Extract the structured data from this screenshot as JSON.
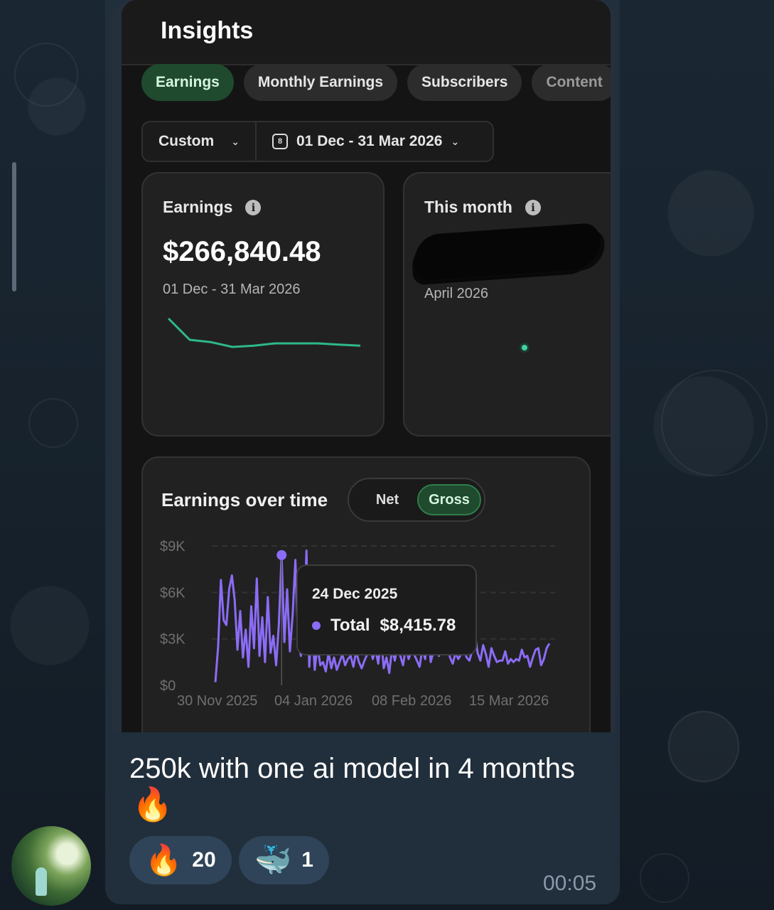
{
  "insights": {
    "title": "Insights",
    "tabs": [
      "Earnings",
      "Monthly Earnings",
      "Subscribers",
      "Content"
    ],
    "filter": {
      "range_type": "Custom",
      "date_range": "01 Dec - 31 Mar 2026"
    },
    "earnings_card": {
      "label": "Earnings",
      "value": "$266,840.48",
      "period": "01 Dec - 31 Mar 2026"
    },
    "month_card": {
      "label": "This month",
      "period": "April 2026"
    },
    "chart_card": {
      "title": "Earnings over time",
      "toggle_net": "Net",
      "toggle_gross": "Gross",
      "tooltip": {
        "date": "24 Dec 2025",
        "label": "Total",
        "value": "$8,415.78"
      }
    }
  },
  "message": {
    "caption": "250k with one ai model in 4 months",
    "emoji": "🔥",
    "reactions": [
      {
        "emoji": "🔥",
        "count": "20"
      },
      {
        "emoji": "🐳",
        "count": "1"
      }
    ],
    "time": "00:05"
  },
  "chart_data": [
    {
      "type": "line",
      "title": "",
      "x": [
        1,
        2,
        3,
        4,
        5,
        6,
        7,
        8,
        9,
        10
      ],
      "values": [
        9.0,
        7.2,
        7.0,
        6.6,
        6.7,
        6.9,
        6.9,
        6.9,
        6.8,
        6.7
      ],
      "color": "#2fb88a",
      "axes_visible": false
    },
    {
      "type": "line",
      "title": "Earnings over time",
      "xlabel": "",
      "ylabel": "",
      "yticks": [
        "$0",
        "$3K",
        "$6K",
        "$9K"
      ],
      "ylim": [
        0,
        9000
      ],
      "xticks": [
        "30 Nov 2025",
        "04 Jan 2026",
        "08 Feb 2026",
        "15 Mar 2026"
      ],
      "grid": true,
      "color": "#8b6cf6",
      "series": [
        {
          "x": [
            "2025-11-30",
            "2025-12-01",
            "2025-12-02",
            "2025-12-03",
            "2025-12-04",
            "2025-12-05",
            "2025-12-06",
            "2025-12-07",
            "2025-12-08",
            "2025-12-09",
            "2025-12-10",
            "2025-12-11",
            "2025-12-12",
            "2025-12-13",
            "2025-12-14",
            "2025-12-15",
            "2025-12-16",
            "2025-12-17",
            "2025-12-18",
            "2025-12-19",
            "2025-12-20",
            "2025-12-21",
            "2025-12-22",
            "2025-12-23",
            "2025-12-24",
            "2025-12-25",
            "2025-12-26",
            "2025-12-27",
            "2025-12-28",
            "2025-12-29",
            "2025-12-30",
            "2025-12-31",
            "2026-01-01",
            "2026-01-02",
            "2026-01-03",
            "2026-01-04",
            "2026-01-05",
            "2026-01-06",
            "2026-01-07",
            "2026-01-08",
            "2026-01-09",
            "2026-01-10",
            "2026-01-11",
            "2026-01-12",
            "2026-01-13",
            "2026-01-14",
            "2026-01-15",
            "2026-01-16",
            "2026-01-17",
            "2026-01-18",
            "2026-01-19",
            "2026-01-20",
            "2026-01-21",
            "2026-01-22",
            "2026-01-23",
            "2026-01-24",
            "2026-01-25",
            "2026-01-26",
            "2026-01-27",
            "2026-01-28",
            "2026-01-29",
            "2026-01-30",
            "2026-01-31",
            "2026-02-01",
            "2026-02-02",
            "2026-02-03",
            "2026-02-04",
            "2026-02-05",
            "2026-02-06",
            "2026-02-07",
            "2026-02-08",
            "2026-02-09",
            "2026-02-10",
            "2026-02-11",
            "2026-02-12",
            "2026-02-13",
            "2026-02-14",
            "2026-02-15",
            "2026-02-16",
            "2026-02-17",
            "2026-02-18",
            "2026-02-19",
            "2026-02-20",
            "2026-02-21",
            "2026-02-22",
            "2026-02-23",
            "2026-02-24",
            "2026-02-25",
            "2026-02-26",
            "2026-02-27",
            "2026-02-28",
            "2026-03-01",
            "2026-03-02",
            "2026-03-03",
            "2026-03-04",
            "2026-03-05",
            "2026-03-06",
            "2026-03-07",
            "2026-03-08",
            "2026-03-09",
            "2026-03-10",
            "2026-03-11",
            "2026-03-12",
            "2026-03-13",
            "2026-03-14",
            "2026-03-15",
            "2026-03-16",
            "2026-03-17",
            "2026-03-18",
            "2026-03-19",
            "2026-03-20",
            "2026-03-21",
            "2026-03-22",
            "2026-03-23",
            "2026-03-24",
            "2026-03-25",
            "2026-03-26",
            "2026-03-27",
            "2026-03-28",
            "2026-03-29",
            "2026-03-30",
            "2026-03-31"
          ],
          "y": [
            200,
            2500,
            6800,
            4200,
            3900,
            6200,
            7100,
            5500,
            2300,
            4800,
            1800,
            3600,
            1200,
            5100,
            2400,
            6900,
            1900,
            4400,
            1500,
            5700,
            2100,
            3200,
            1300,
            3900,
            8415,
            2800,
            6200,
            2200,
            4600,
            8100,
            2900,
            1900,
            3400,
            8700,
            1200,
            4100,
            1000,
            2600,
            1300,
            1500,
            900,
            2100,
            1100,
            1800,
            1000,
            1500,
            2000,
            1300,
            1700,
            1900,
            1200,
            2200,
            1500,
            1100,
            1600,
            2000,
            2800,
            1700,
            2300,
            1400,
            3100,
            1100,
            1800,
            800,
            2400,
            1600,
            2600,
            1900,
            1300,
            2500,
            1700,
            2200,
            2000,
            1600,
            1200,
            2400,
            1700,
            3800,
            1500,
            2200,
            2500,
            1900,
            2400,
            3400,
            2600,
            1800,
            1400,
            2100,
            1700,
            2000,
            2300,
            1800,
            1600,
            2200,
            3300,
            2100,
            1600,
            2600,
            2000,
            1200,
            2400,
            1900,
            1500,
            1600,
            1600,
            2200,
            1400,
            1700,
            1500,
            1700,
            1600,
            2300,
            1800,
            1900,
            1200,
            1800,
            2300,
            2400,
            1300,
            1700,
            2400,
            2700
          ]
        }
      ]
    }
  ]
}
